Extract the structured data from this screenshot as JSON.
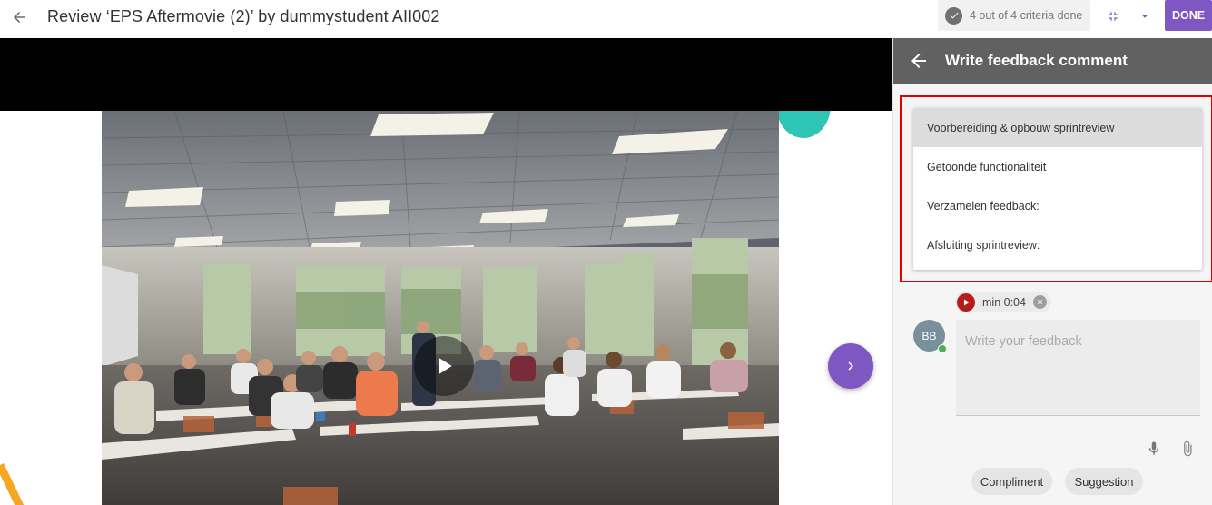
{
  "topbar": {
    "title": "Review ‘EPS Aftermovie (2)’ by dummystudent AII002",
    "criteria_status": "4 out of 4 criteria done",
    "done_label": "DONE"
  },
  "panel": {
    "title": "Write feedback comment",
    "criteria_options": [
      "Voorbereiding & opbouw sprintreview",
      "Getoonde functionaliteit",
      "Verzamelen feedback:",
      "Afsluiting sprintreview:"
    ],
    "selected_option": 0,
    "timestamp_label": "min 0:04",
    "avatar_initials": "BB",
    "feedback_placeholder": "Write your feedback",
    "chips": [
      "Compliment",
      "Suggestion"
    ]
  },
  "colors": {
    "accent": "#7e57c2",
    "panel_header": "#616161",
    "teal": "#2ec4b6",
    "timestamp_play": "#b71c1c",
    "highlight": "#e00000",
    "online": "#4caf50"
  },
  "icons": {
    "back": "arrow-left-icon",
    "check": "check-circle-icon",
    "collapse": "fullscreen-exit-icon",
    "dropdown": "caret-down-icon",
    "play": "play-icon",
    "next": "chevron-right-icon",
    "close": "close-icon",
    "mic": "microphone-icon",
    "attach": "paperclip-icon"
  }
}
